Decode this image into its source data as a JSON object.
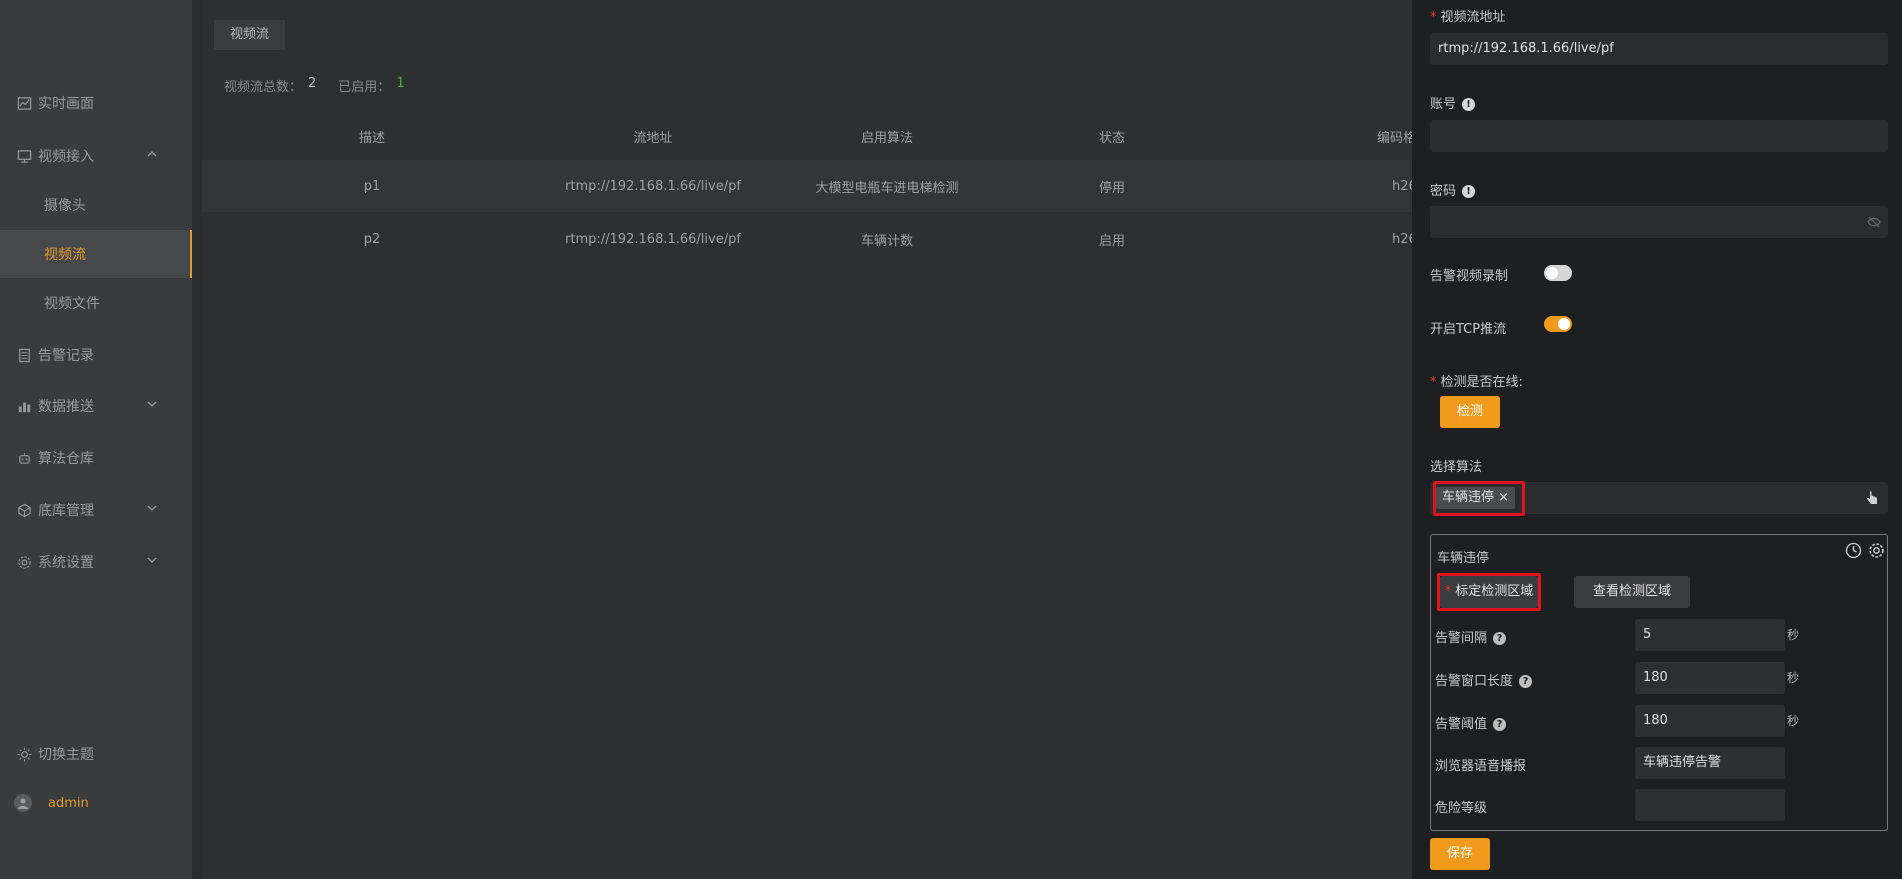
{
  "sidebar": {
    "items": [
      {
        "label": "实时画面",
        "icon": "line-chart-icon"
      },
      {
        "label": "视频接入",
        "icon": "monitor-icon",
        "expanded": true
      },
      {
        "label": "摄像头",
        "sub": true
      },
      {
        "label": "视频流",
        "sub": true,
        "active": true
      },
      {
        "label": "视频文件",
        "sub": true
      },
      {
        "label": "告警记录",
        "icon": "document-icon"
      },
      {
        "label": "数据推送",
        "icon": "bar-chart-icon"
      },
      {
        "label": "算法仓库",
        "icon": "robot-icon"
      },
      {
        "label": "底库管理",
        "icon": "cube-icon"
      },
      {
        "label": "系统设置",
        "icon": "gear-icon"
      }
    ],
    "theme_label": "切换主题",
    "user_name": "admin"
  },
  "main": {
    "tab": "视频流",
    "stats": {
      "total_label": "视频流总数：",
      "total": "2",
      "enabled_label": "已启用：",
      "enabled": "1"
    },
    "columns": [
      "描述",
      "流地址",
      "启用算法",
      "状态",
      "编码格"
    ],
    "rows": [
      {
        "desc": "p1",
        "url": "rtmp://192.168.1.66/live/pf",
        "algo": "大模型电瓶车进电梯检测",
        "status": "停用",
        "codec": "h26"
      },
      {
        "desc": "p2",
        "url": "rtmp://192.168.1.66/live/pf",
        "algo": "车辆计数",
        "status": "启用",
        "codec": "h26"
      }
    ]
  },
  "drawer": {
    "url_label": "视频流地址",
    "url_value": "rtmp://192.168.1.66/live/pf",
    "account_label": "账号",
    "account_value": "",
    "password_label": "密码",
    "password_value": "",
    "record_label": "告警视频录制",
    "record_on": false,
    "tcp_label": "开启TCP推流",
    "tcp_on": true,
    "online_label": "检测是否在线:",
    "check_button": "检测",
    "algo_label": "选择算法",
    "selected_algo": "车辆违停",
    "panel": {
      "title": "车辆违停",
      "mark_button": "标定检测区域",
      "view_button": "查看检测区域",
      "interval_label": "告警间隔",
      "interval_value": "5",
      "window_label": "告警窗口长度",
      "window_value": "180",
      "threshold_label": "告警阈值",
      "threshold_value": "180",
      "unit": "秒",
      "voice_label": "浏览器语音播报",
      "voice_value": "车辆违停告警",
      "risk_label": "危险等级",
      "risk_value": ""
    },
    "save_button": "保存",
    "accent_color": "#f19a1c"
  }
}
